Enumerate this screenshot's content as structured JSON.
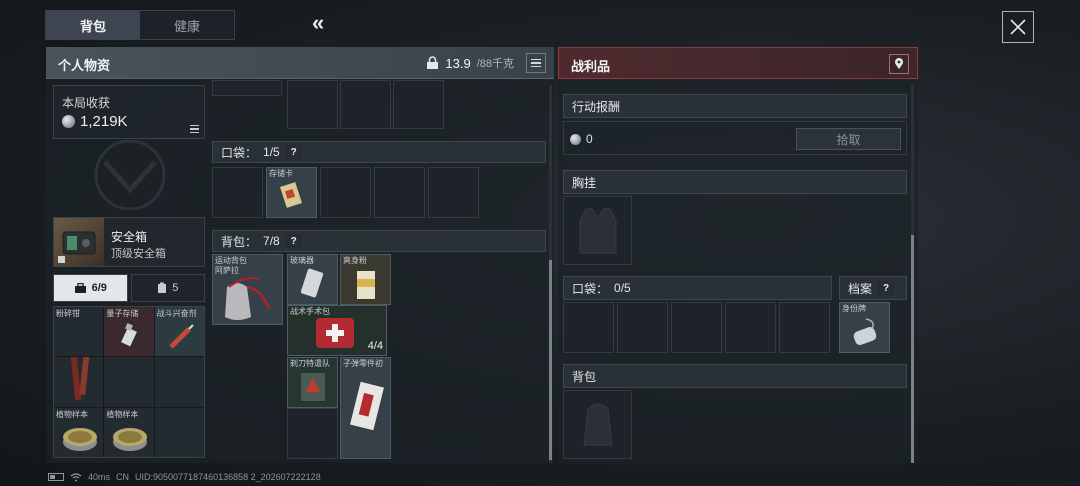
{
  "top_tabs": [
    {
      "label": "背包",
      "active": true
    },
    {
      "label": "健康",
      "active": false
    }
  ],
  "collapse_glyph": "«",
  "personal": {
    "title": "个人物资",
    "weight_current": "13.9",
    "weight_max": "/88千克",
    "income_label": "本局收获",
    "income_value": "1,219K",
    "safe_name": "安全箱",
    "safe_sub": "顶级安全箱",
    "subtab_tools": "6/9",
    "subtab_cards": "5",
    "items": [
      {
        "name": "粉碎钳"
      },
      {
        "name": "量子存储"
      },
      {
        "name": "战斗兴奋剂"
      },
      {
        "name": ""
      },
      {
        "name": ""
      },
      {
        "name": ""
      },
      {
        "name": "植物样本"
      },
      {
        "name": "植物样本"
      },
      {
        "name": ""
      }
    ]
  },
  "pocket": {
    "label": "口袋：",
    "count": "1/5",
    "help": "?",
    "item_name": "存储卡"
  },
  "backpack": {
    "label": "背包：",
    "count": "7/8",
    "help": "?",
    "bag_name": "运动背包",
    "bag_sub": "阿萨拉",
    "items": [
      {
        "name": "玻璃器"
      },
      {
        "name": "爽身粉"
      },
      {
        "name": "战术手术包",
        "count": "4/4"
      },
      {
        "name": "剃刀特遣队"
      },
      {
        "name": "子弹零件初"
      }
    ]
  },
  "loot": {
    "title": "战利品",
    "reward_label": "行动报酬",
    "reward_value": "0",
    "pickup_label": "拾取",
    "vest_label": "胸挂",
    "pocket_label": "口袋：",
    "pocket_count": "0/5",
    "archive_label": "档案",
    "archive_help": "?",
    "archive_item": "身份牌",
    "backpack_label": "背包"
  },
  "status_bar": {
    "ping": "40ms",
    "region": "CN",
    "uid": "UID:9050077187460136858 2_202607222128"
  },
  "colors": {
    "loot_accent": "#8c3a3f",
    "tab_active": "#3d4650"
  }
}
